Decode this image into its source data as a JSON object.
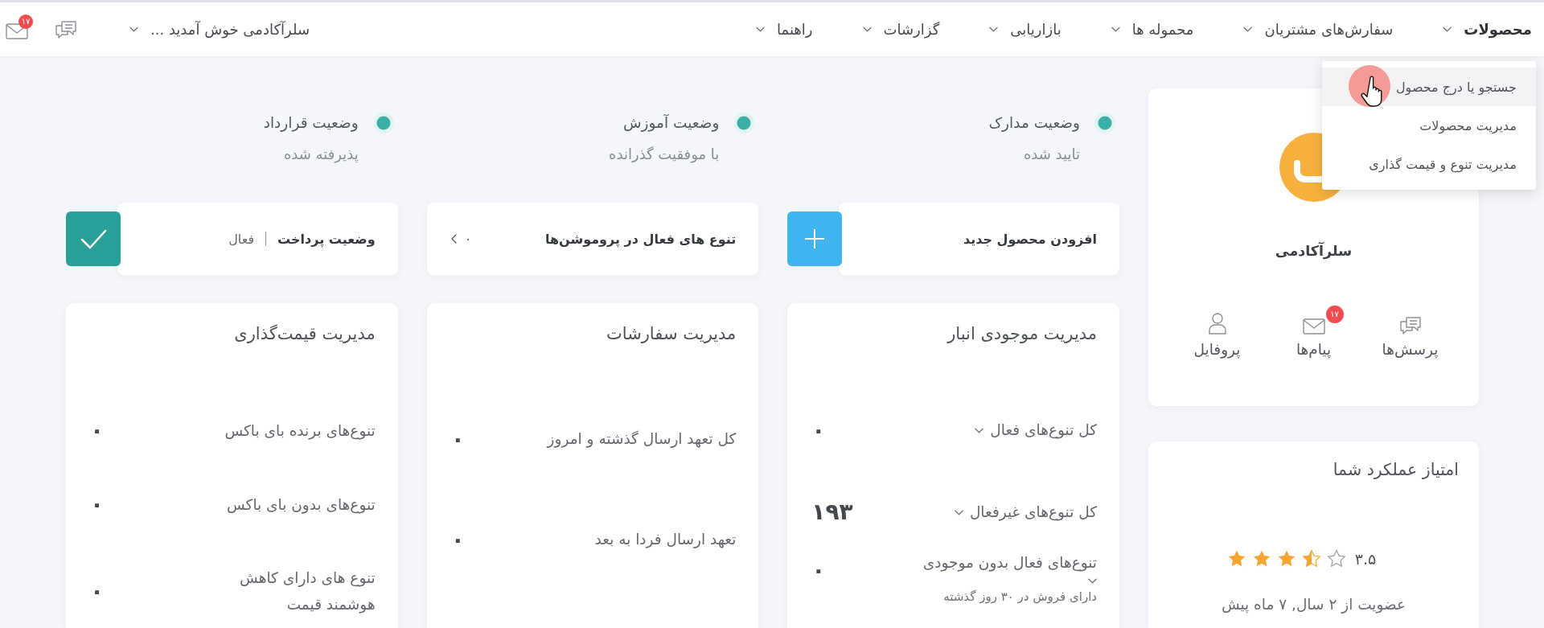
{
  "top_bar": {
    "nav": [
      {
        "label": "محصولات",
        "expanded": true,
        "menu": [
          {
            "label": "جستجو یا درج محصول",
            "hovered": true
          },
          {
            "label": "مدیریت محصولات",
            "hovered": false
          },
          {
            "label": "مدیریت تنوع و قیمت گذاری",
            "hovered": false
          }
        ]
      },
      {
        "label": "سفارش‌های مشتریان",
        "expanded": false
      },
      {
        "label": "محموله ها",
        "expanded": false
      },
      {
        "label": "بازاریابی",
        "expanded": false
      },
      {
        "label": "گزارشات",
        "expanded": false
      },
      {
        "label": "راهنما",
        "expanded": false
      }
    ],
    "user_menu": {
      "label": "سلرآکادمی خوش آمدید ..."
    },
    "mail_badge": "۱۷"
  },
  "profile": {
    "name": "سلرآکادمی",
    "links": [
      {
        "kind": "questions",
        "label": "پرسش‌ها"
      },
      {
        "kind": "messages",
        "label": "پیام‌ها",
        "badge": "۱۷"
      },
      {
        "kind": "profile",
        "label": "پروفایل"
      }
    ]
  },
  "performance": {
    "title": "امتیاز عملکرد شما",
    "stars": 3.5,
    "rating": "۳.۵",
    "membership": "عضویت از ۲ سال, ۷ ماه پیش"
  },
  "statuses": [
    {
      "label": "وضعیت مدارک",
      "value": "تایید شده"
    },
    {
      "label": "وضعیت آموزش",
      "value": "با موفقیت گذرانده"
    },
    {
      "label": "وضعیت قرارداد",
      "value": "پذیرفته شده"
    }
  ],
  "actions": [
    {
      "kind": "add",
      "label": "افزودن محصول جدید"
    },
    {
      "kind": "count",
      "label": "تنوع های فعال در پروموشن‌ها",
      "value": "۰"
    },
    {
      "kind": "status",
      "label": "وضعیت پرداخت",
      "value": "فعال"
    }
  ],
  "cards": [
    {
      "title": "مدیریت موجودی انبار",
      "rows": [
        {
          "kind": "inline",
          "label": "کل تنوع‌های فعال",
          "value": "۰"
        },
        {
          "kind": "inline",
          "label": "کل تنوع‌های غیرفعال",
          "value": "۱۹۳"
        },
        {
          "kind": "detail",
          "label": "تنوع‌های فعال بدون موجودی",
          "note": "دارای فروش در ۳۰ روز گذشته",
          "value": "۰"
        }
      ]
    },
    {
      "title": "مدیریت سفارشات",
      "rows": [
        {
          "kind": "plain",
          "label": "کل تعهد ارسال گذشته و امروز",
          "value": "۰"
        },
        {
          "kind": "plain",
          "label": "تعهد ارسال فردا به بعد",
          "value": "۰"
        }
      ]
    },
    {
      "title": "مدیریت قیمت‌گذاری",
      "rows": [
        {
          "kind": "plain",
          "label": "تنوع‌های برنده بای باکس",
          "value": "۰"
        },
        {
          "kind": "plain",
          "label": "تنوع‌های بدون بای باکس",
          "value": "۰"
        },
        {
          "kind": "plain",
          "label": "تنوع های دارای کاهش هوشمند قیمت",
          "value": "۰"
        }
      ]
    }
  ]
}
